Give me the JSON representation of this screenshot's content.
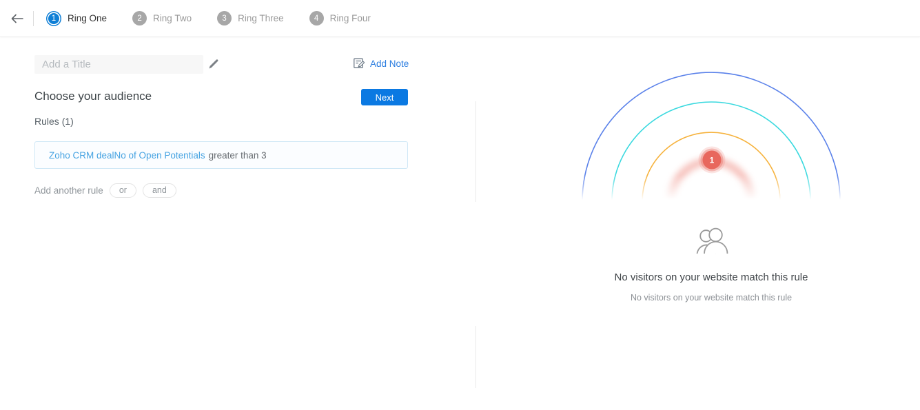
{
  "header": {
    "steps": [
      {
        "num": "1",
        "label": "Ring One"
      },
      {
        "num": "2",
        "label": "Ring Two"
      },
      {
        "num": "3",
        "label": "Ring Three"
      },
      {
        "num": "4",
        "label": "Ring Four"
      }
    ]
  },
  "editor": {
    "title_placeholder": "Add a Title",
    "add_note_label": "Add Note",
    "audience_heading": "Choose your audience",
    "next_label": "Next",
    "rules_label": "Rules",
    "rules_count": "(1)",
    "rule": {
      "condition": "Zoho CRM dealNo of Open Potentials",
      "criteria": "greater than 3"
    },
    "add_another_rule_label": "Add another rule",
    "or_label": "or",
    "and_label": "and"
  },
  "preview": {
    "badge_count": "1",
    "empty_title": "No visitors on your website match this rule",
    "empty_subtitle": "No visitors on your website match this rule",
    "ring_colors": {
      "outer": "#5b82ea",
      "second": "#3bd9df",
      "third": "#f6b23c",
      "inner_glow": "#f0958c",
      "badge": "#e8675d"
    }
  },
  "icons": {
    "back": "arrow-left",
    "edit_title": "pencil",
    "add_note": "note-pencil",
    "empty_state": "people-outline"
  },
  "colors": {
    "step_active": "#0f7fd6",
    "step_inactive": "#a7a7a7",
    "accent_blue": "#0b79e2",
    "link_blue": "#2b7de0",
    "rule_link_blue": "#46a3e2"
  }
}
